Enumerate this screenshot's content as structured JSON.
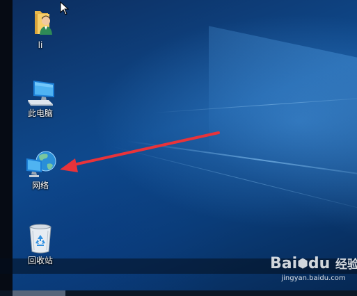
{
  "desktop": {
    "icons": [
      {
        "id": "user-folder",
        "label": "li",
        "icon": "user-folder-icon"
      },
      {
        "id": "this-pc",
        "label": "此电脑",
        "icon": "computer-icon"
      },
      {
        "id": "network",
        "label": "网络",
        "icon": "network-icon"
      },
      {
        "id": "recycle-bin",
        "label": "回收站",
        "icon": "recycle-bin-icon"
      }
    ]
  },
  "annotation": {
    "arrow_color": "#e8333a",
    "points_to": "network"
  },
  "watermark": {
    "logo_text": "Bai",
    "logo_suffix": "du",
    "logo_cn": "经验",
    "url": "jingyan.baidu.com"
  },
  "colors": {
    "wallpaper_dark": "#0c2d5e",
    "wallpaper_mid": "#0f4b8f",
    "label_text": "#ffffff"
  }
}
